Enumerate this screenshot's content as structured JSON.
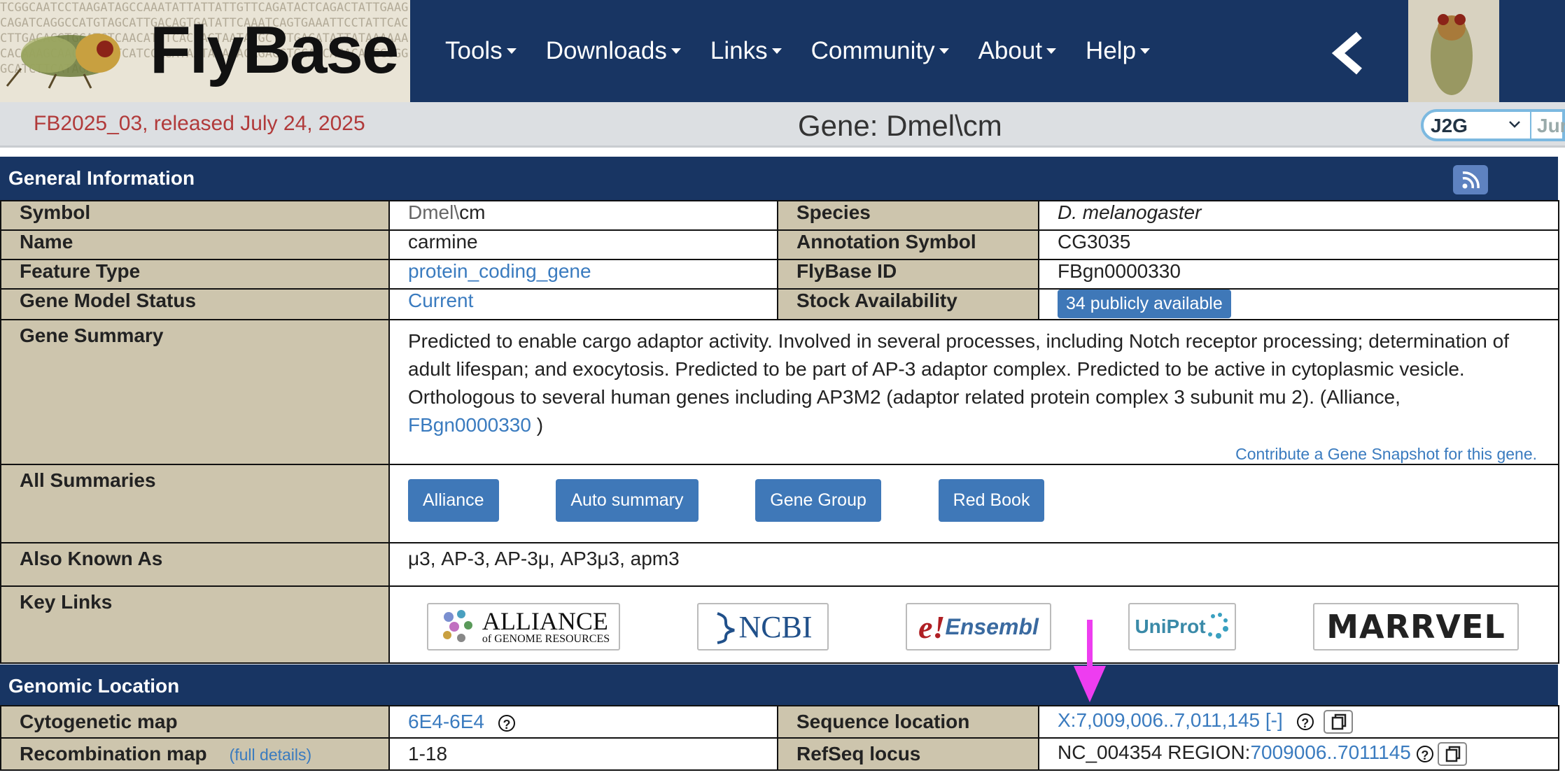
{
  "header": {
    "logo_text": "FlyBase",
    "dna_text": "TCGGCAATCCTAAGATAGCCAAATATTATTATTGTTCAGATACTCAGACTATTGAAGCAGATCAGGCCATGTAGCATTGACAGTGATATTCAAATCAGTGAAATTCCTATTCACCTTGACACGTGCATGTCAACATTTCACCAGTAATACGCTTTGACATATTATAAAAAACACAAAGCAACATGGTTCATCCAGATAATAAAAACAGACGTGCAACACACAGCCGGGGCATCTTCATAGA",
    "nav": [
      {
        "label": "Tools"
      },
      {
        "label": "Downloads"
      },
      {
        "label": "Links"
      },
      {
        "label": "Community"
      },
      {
        "label": "About"
      },
      {
        "label": "Help"
      }
    ]
  },
  "subbar": {
    "release": "FB2025_03, released July 24, 2025",
    "title": "Gene: Dmel\\cm",
    "select_value": "J2G",
    "jump_placeholder": "Jur"
  },
  "general": {
    "section_title": "General Information",
    "symbol_label": "Symbol",
    "symbol_prefix": "Dmel\\",
    "symbol_value": "cm",
    "species_label": "Species",
    "species_value": "D. melanogaster",
    "name_label": "Name",
    "name_value": "carmine",
    "annot_label": "Annotation Symbol",
    "annot_value": "CG3035",
    "feature_label": "Feature Type",
    "feature_value": "protein_coding_gene",
    "fbid_label": "FlyBase ID",
    "fbid_value": "FBgn0000330",
    "model_label": "Gene Model Status",
    "model_value": "Current",
    "stock_label": "Stock Availability",
    "stock_value": "34 publicly available",
    "summary_label": "Gene Summary",
    "summary_text": "Predicted to enable cargo adaptor activity. Involved in several processes, including Notch receptor processing; determination of adult lifespan; and exocytosis. Predicted to be part of AP-3 adaptor complex. Predicted to be active in cytoplasmic vesicle. Orthologous to several human genes including AP3M2 (adaptor related protein complex 3 subunit mu 2). (Alliance,",
    "summary_link": "FBgn0000330",
    "summary_close": " )",
    "contribute": "Contribute a Gene Snapshot for this gene.",
    "all_summaries_label": "All Summaries",
    "summary_buttons": [
      "Alliance",
      "Auto summary",
      "Gene Group",
      "Red Book"
    ],
    "aka_label": "Also Known As",
    "aka_value": "μ3, AP-3, AP-3μ, AP3μ3, apm3",
    "keylinks_label": "Key Links",
    "keylinks": {
      "alliance_main": "ALLIANCE",
      "alliance_sub": "of GENOME RESOURCES",
      "ncbi": "NCBI",
      "ensembl": "Ensembl",
      "uniprot": "UniProt",
      "marrvel": "MARRVEL"
    }
  },
  "genomic": {
    "section_title": "Genomic Location",
    "cyto_label": "Cytogenetic map",
    "cyto_value": "6E4-6E4",
    "seq_label": "Sequence location",
    "seq_value": "X:7,009,006..7,011,145 [-]",
    "recomb_label": "Recombination map",
    "recomb_link": "(full details)",
    "recomb_value": "1-18",
    "refseq_label": "RefSeq locus",
    "refseq_prefix": "NC_004354 REGION:",
    "refseq_link": "7009006..7011145",
    "qmark": "?"
  },
  "colors": {
    "header_bg": "#183563",
    "label_bg": "#cdc5ad",
    "link": "#3a7bbf",
    "button": "#3f78b8",
    "release_text": "#b13a3a",
    "annotation_arrow": "#ee3df0"
  }
}
